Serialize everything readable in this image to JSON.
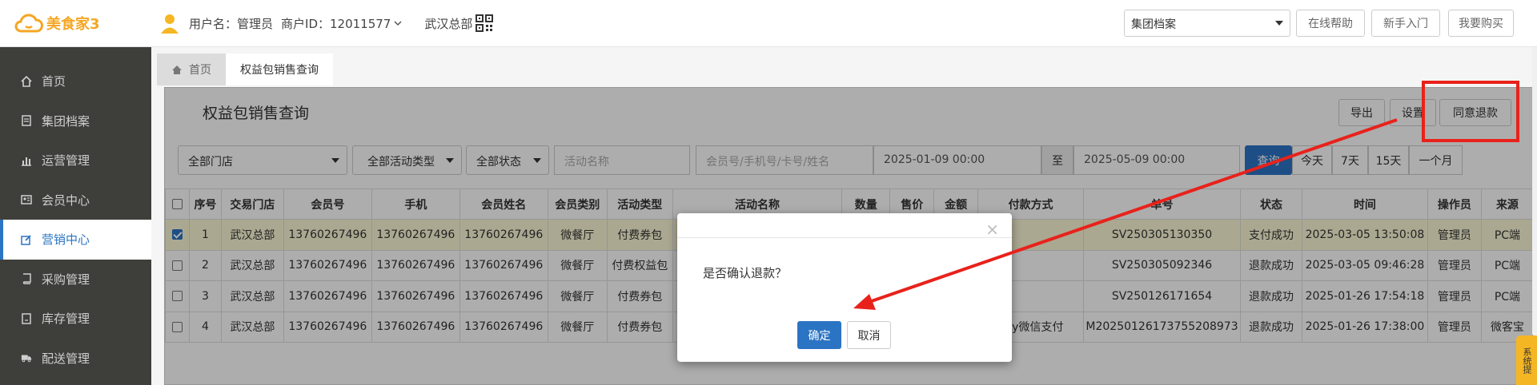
{
  "header": {
    "logo_text": "美食家3",
    "user_label": "用户名：管理员",
    "merchant_label": "商户ID：12011577",
    "org": "武汉总部",
    "archive_select": "集团档案",
    "buttons": [
      "在线帮助",
      "新手入门",
      "我要购买"
    ]
  },
  "sidebar": {
    "items": [
      {
        "label": "首页",
        "icon": "home-icon"
      },
      {
        "label": "集团档案",
        "icon": "document-icon"
      },
      {
        "label": "运营管理",
        "icon": "bar-chart-icon"
      },
      {
        "label": "会员中心",
        "icon": "id-card-icon"
      },
      {
        "label": "营销中心",
        "icon": "edit-icon"
      },
      {
        "label": "采购管理",
        "icon": "book-icon"
      },
      {
        "label": "库存管理",
        "icon": "file-icon"
      },
      {
        "label": "配送管理",
        "icon": "truck-icon"
      }
    ],
    "active_index": 4
  },
  "tabs": {
    "home": "首页",
    "current": "权益包销售查询"
  },
  "panel": {
    "title": "权益包销售查询",
    "actions": {
      "export": "导出",
      "settings": "设置",
      "refund": "同意退款"
    },
    "filters": {
      "store": "全部门店",
      "activity_type": "全部活动类型",
      "status": "全部状态",
      "activity_name_placeholder": "活动名称",
      "member_placeholder": "会员号/手机号/卡号/姓名",
      "date_from": "2025-01-09 00:00",
      "to": "至",
      "date_to": "2025-05-09 00:00",
      "query": "查询",
      "quick": [
        "今天",
        "7天",
        "15天",
        "一个月"
      ]
    },
    "table": {
      "columns": [
        "序号",
        "交易门店",
        "会员号",
        "手机",
        "会员姓名",
        "会员类别",
        "活动类型",
        "活动名称",
        "数量",
        "售价",
        "金额",
        "付款方式",
        "单号",
        "状态",
        "时间",
        "操作员",
        "来源"
      ],
      "rows": [
        {
          "checked": true,
          "cells": [
            "1",
            "武汉总部",
            "13760267496",
            "13760267496",
            "13760267496",
            "微餐厅",
            "付费券包",
            "",
            "",
            "",
            "",
            "",
            "SV250305130350",
            "支付成功",
            "2025-03-05 13:50:08",
            "管理员",
            "PC端"
          ]
        },
        {
          "checked": false,
          "cells": [
            "2",
            "武汉总部",
            "13760267496",
            "13760267496",
            "13760267496",
            "微餐厅",
            "付费权益包",
            "",
            "",
            "",
            "",
            "",
            "SV250305092346",
            "退款成功",
            "2025-03-05 09:46:28",
            "管理员",
            "PC端"
          ]
        },
        {
          "checked": false,
          "cells": [
            "3",
            "武汉总部",
            "13760267496",
            "13760267496",
            "13760267496",
            "微餐厅",
            "付费券包",
            "",
            "",
            "",
            "",
            "",
            "SV250126171654",
            "退款成功",
            "2025-01-26 17:54:18",
            "管理员",
            "PC端"
          ]
        },
        {
          "checked": false,
          "cells": [
            "4",
            "武汉总部",
            "13760267496",
            "13760267496",
            "13760267496",
            "微餐厅",
            "付费券包",
            "",
            "",
            "",
            "",
            "pay微信支付",
            "M20250126173755208973",
            "退款成功",
            "2025-01-26 17:38:00",
            "管理员",
            "微客宝"
          ]
        }
      ]
    }
  },
  "modal": {
    "message": "是否确认退款？",
    "ok": "确定",
    "cancel": "取消"
  },
  "side_tab": "系统提",
  "colors": {
    "primary": "#2b74c4",
    "sidebar_bg": "#3e3f3b",
    "annotation": "#e8221b",
    "logo": "#f5a623",
    "selected_row": "#fdf8d6"
  }
}
